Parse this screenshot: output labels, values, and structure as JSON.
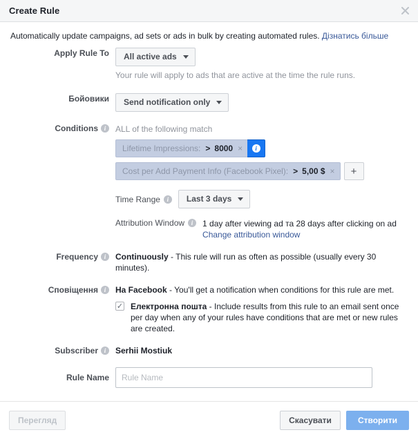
{
  "window": {
    "title": "Create Rule",
    "close_icon": "close-icon"
  },
  "intro": {
    "text": "Automatically update campaigns, ad sets or ads in bulk by creating automated rules. ",
    "link": "Дізнатись більше"
  },
  "apply_rule_to": {
    "label": "Apply Rule To",
    "value": "All active ads",
    "helper": "Your rule will apply to ads that are active at the time the rule runs."
  },
  "action": {
    "label": "Бойовики",
    "value": "Send notification only"
  },
  "conditions": {
    "label": "Conditions",
    "match_text": "ALL of the following match",
    "items": [
      {
        "name": "Lifetime Impressions:",
        "operator": ">",
        "value": "8000",
        "remove_icon": "×",
        "has_info_button": true
      },
      {
        "name": "Cost per Add Payment Info (Facebook Pixel):",
        "operator": ">",
        "value": "5,00 $",
        "remove_icon": "×",
        "has_info_button": false
      }
    ],
    "add_label": "+"
  },
  "time_range": {
    "label": "Time Range",
    "value": "Last 3 days"
  },
  "attribution_window": {
    "label": "Attribution Window",
    "value": "1 day after viewing ad та 28 days after clicking on ad",
    "change_link": "Change attribution window"
  },
  "frequency": {
    "label": "Frequency",
    "value": "Continuously",
    "description": " - This rule will run as often as possible (usually every 30 minutes)."
  },
  "notifications": {
    "label": "Сповіщення",
    "facebook": {
      "title": "На Facebook",
      "description": " - You'll get a notification when conditions for this rule are met."
    },
    "email": {
      "checked": true,
      "check_glyph": "✓",
      "title": "Електронна пошта",
      "description": " - Include results from this rule to an email sent once per day when any of your rules have conditions that are met or new rules are created."
    }
  },
  "subscriber": {
    "label": "Subscriber",
    "value": "Serhii Mostiuk"
  },
  "rule_name": {
    "label": "Rule Name",
    "value": "",
    "placeholder": "Rule Name"
  },
  "footer": {
    "preview": "Перегляд",
    "cancel": "Скасувати",
    "create": "Створити"
  },
  "colors": {
    "accent_blue": "#1877f2",
    "link_blue": "#385898",
    "primary_button": "#7cb0ee",
    "pill_background": "#c3cde1",
    "header_background": "#f5f6f7"
  }
}
